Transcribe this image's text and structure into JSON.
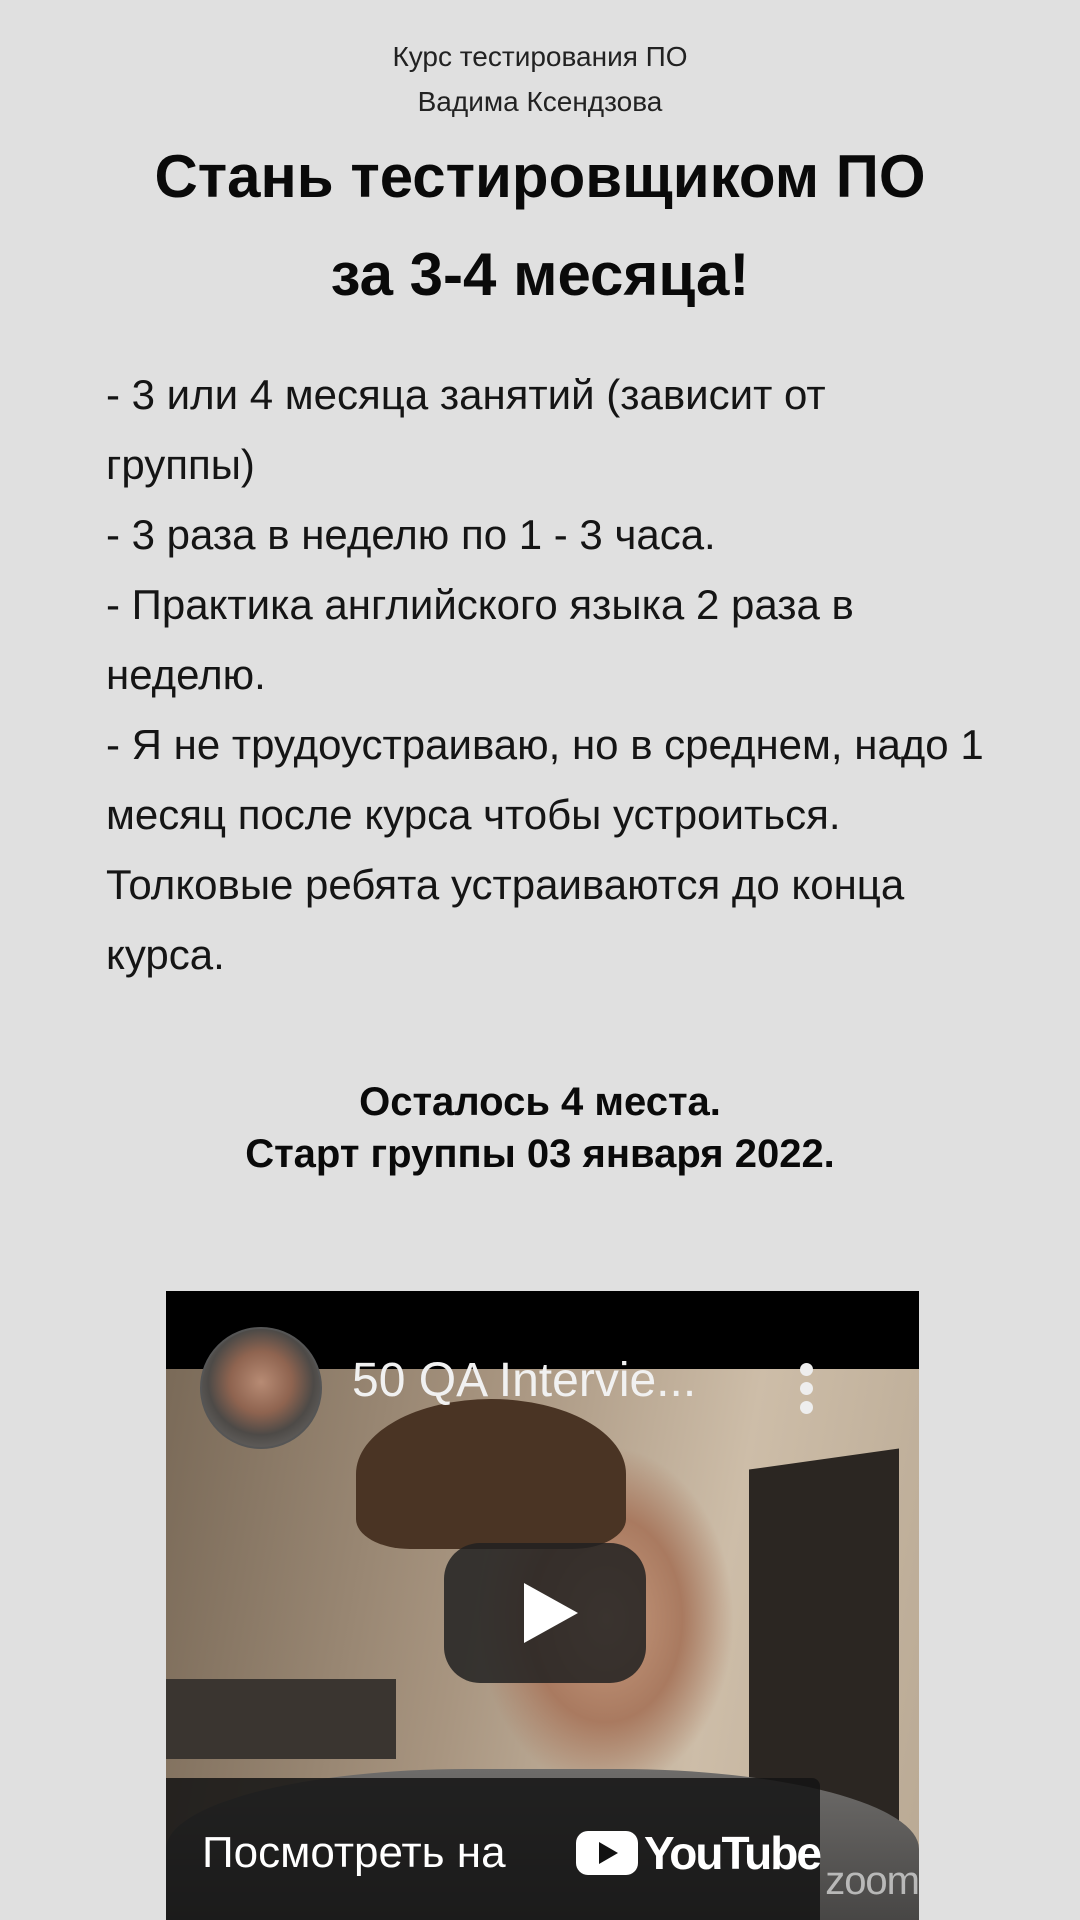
{
  "course": {
    "line1": "Курс тестирования ПО",
    "line2": "Вадима Ксендзова"
  },
  "headline": {
    "line1": "Стань тестировщиком ПО",
    "line2": "за 3-4 месяца!"
  },
  "features": [
    "- 3 или 4 месяца занятий (зависит от группы)",
    "- 3 раза в неделю по 1 - 3 часа.",
    "- Практика английского языка 2 раза в неделю.",
    "- Я не трудоустраиваю, но в среднем, надо 1 месяц после курса чтобы устроиться. Толковые ребята устраиваются до конца курса."
  ],
  "status": {
    "seats": "Осталось 4 места.",
    "start": "Старт группы 03 января 2022."
  },
  "video": {
    "title": "50 QA Intervie...",
    "watch_label": "Посмотреть на",
    "platform": "YouTube",
    "watermark": "zoom"
  },
  "colors": {
    "background": "#e0e0e0",
    "text": "#111111",
    "video_bg": "#000000"
  },
  "icons": [
    "channel-avatar",
    "more-vert-icon",
    "play-icon",
    "youtube-logo-icon"
  ]
}
